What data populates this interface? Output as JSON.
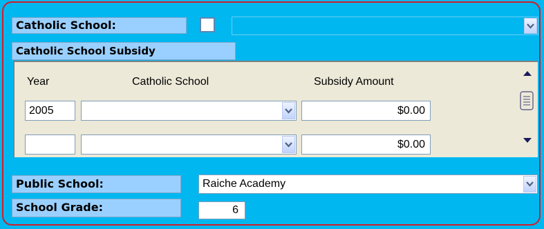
{
  "catholic_school": {
    "label": "Catholic School:",
    "checked": false,
    "selected_value": ""
  },
  "subsidy_section": {
    "title": "Catholic School Subsidy",
    "columns": [
      "Year",
      "Catholic School",
      "Subsidy Amount"
    ],
    "rows": [
      {
        "year": "2005",
        "school": "",
        "amount": "$0.00"
      },
      {
        "year": "",
        "school": "",
        "amount": "$0.00"
      }
    ]
  },
  "public_school": {
    "label": "Public School:",
    "value": "Raiche Academy"
  },
  "school_grade": {
    "label": "School Grade:",
    "value": "6"
  },
  "icons": {
    "dropdown": "chevron-down-icon",
    "scroll_up": "arrow-up-icon",
    "scroll_down": "arrow-down-icon",
    "scroll_thumb": "scroll-thumb-icon"
  },
  "colors": {
    "background": "#00b7f0",
    "label_bg": "#9ad0ff",
    "frame_border": "#d21e2a",
    "panel_bg": "#ece9d8"
  }
}
